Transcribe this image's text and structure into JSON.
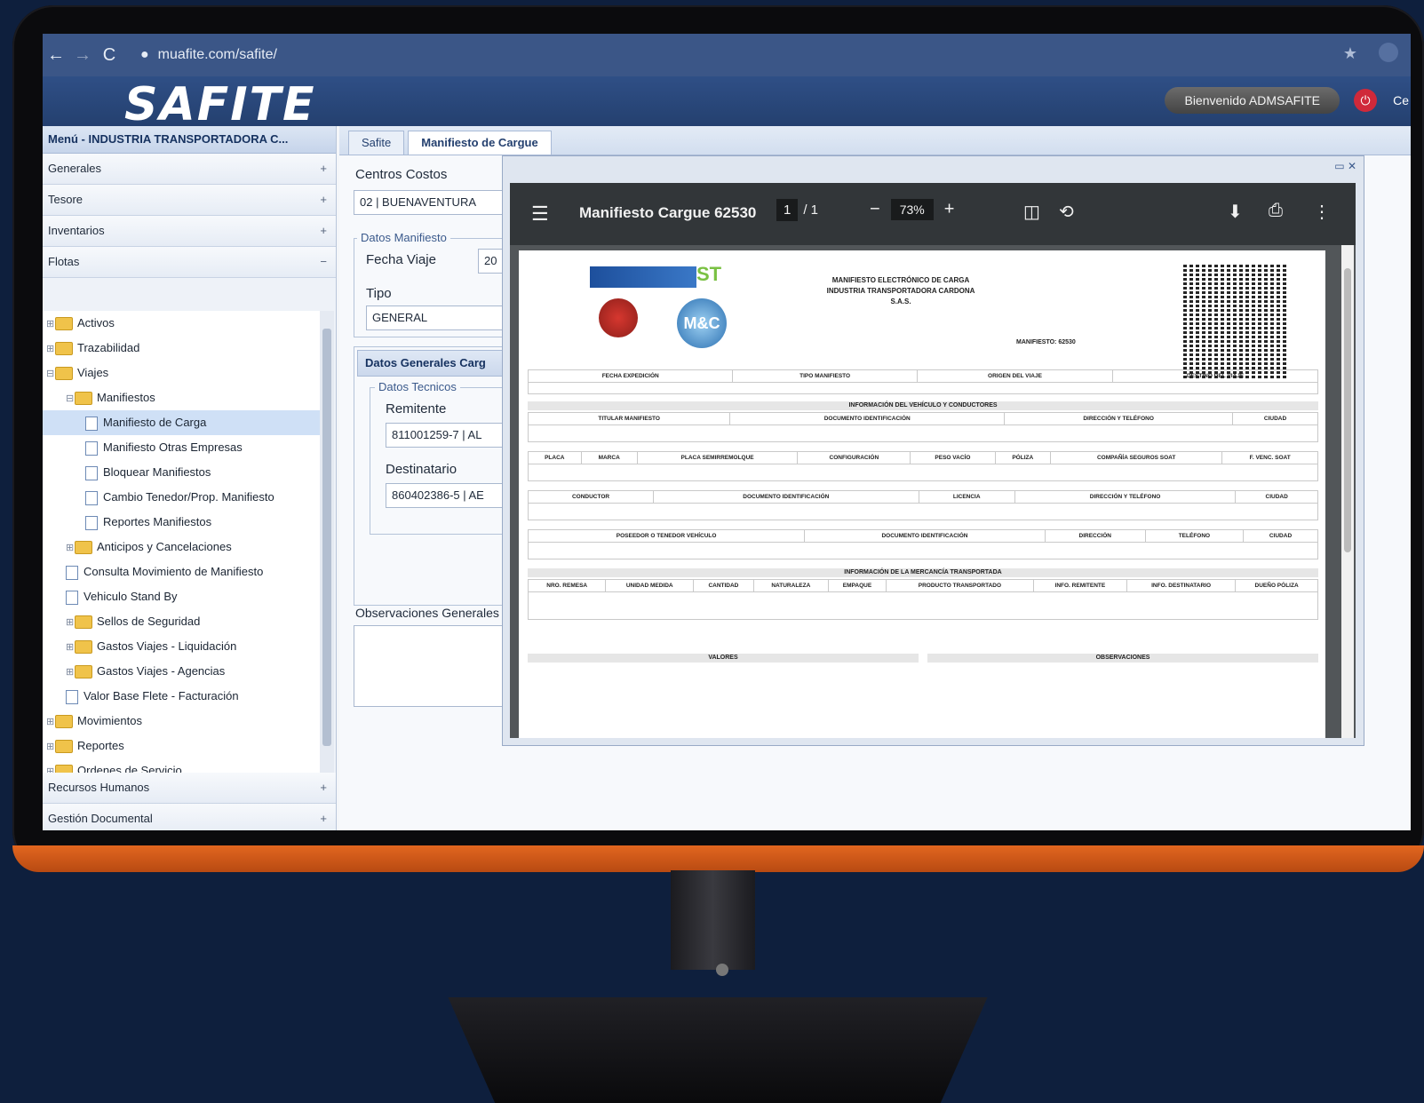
{
  "browser": {
    "back_icon": "←",
    "forward_icon": "→",
    "reload_icon": "C",
    "url": "muafite.com/safite/"
  },
  "app": {
    "logo": "SAFITE",
    "welcome": "Bienvenido ADMSAFITE",
    "logout_text": "Ce"
  },
  "sidebar": {
    "menu_title": "Menú - INDUSTRIA TRANSPORTADORA C...",
    "accordions_top": [
      "Generales",
      "Tesore",
      "Inventarios",
      "Flotas"
    ],
    "tree": [
      {
        "label": "Activos",
        "kind": "folder",
        "level": 0,
        "pm": "+"
      },
      {
        "label": "Trazabilidad",
        "kind": "folder",
        "level": 0,
        "pm": "+"
      },
      {
        "label": "Viajes",
        "kind": "folder",
        "level": 0,
        "pm": "-"
      },
      {
        "label": "Manifiestos",
        "kind": "folder",
        "level": 1,
        "pm": "-"
      },
      {
        "label": "Manifiesto de Carga",
        "kind": "doc",
        "level": 2,
        "selected": true
      },
      {
        "label": "Manifiesto Otras Empresas",
        "kind": "doc",
        "level": 2
      },
      {
        "label": "Bloquear Manifiestos",
        "kind": "doc",
        "level": 2
      },
      {
        "label": "Cambio Tenedor/Prop. Manifiesto",
        "kind": "doc",
        "level": 2
      },
      {
        "label": "Reportes Manifiestos",
        "kind": "doc",
        "level": 2
      },
      {
        "label": "Anticipos y Cancelaciones",
        "kind": "folder",
        "level": 1,
        "pm": "+"
      },
      {
        "label": "Consulta Movimiento de Manifiesto",
        "kind": "doc",
        "level": 1
      },
      {
        "label": "Vehiculo Stand By",
        "kind": "doc",
        "level": 1
      },
      {
        "label": "Sellos de Seguridad",
        "kind": "folder",
        "level": 1,
        "pm": "+"
      },
      {
        "label": "Gastos Viajes - Liquidación",
        "kind": "folder",
        "level": 1,
        "pm": "+"
      },
      {
        "label": "Gastos Viajes - Agencias",
        "kind": "folder",
        "level": 1,
        "pm": "+"
      },
      {
        "label": "Valor Base Flete - Facturación",
        "kind": "doc",
        "level": 1
      },
      {
        "label": "Movimientos",
        "kind": "folder",
        "level": 0,
        "pm": "+"
      },
      {
        "label": "Reportes",
        "kind": "folder",
        "level": 0,
        "pm": "+"
      },
      {
        "label": "Ordenes de Servicio",
        "kind": "folder",
        "level": 0,
        "pm": "+"
      }
    ],
    "accordions_bottom": [
      "Recursos Humanos",
      "Gestión Documental"
    ]
  },
  "main": {
    "tabs": [
      "Safite",
      "Manifiesto de Cargue"
    ],
    "centros_label": "Centros Costos",
    "centros_value": "02 | BUENAVENTURA",
    "datos_manifiesto_legend": "Datos Manifiesto",
    "fecha_label": "Fecha Viaje",
    "fecha_value": "20",
    "tipo_label": "Tipo",
    "tipo_value": "GENERAL",
    "panel_title": "Datos Generales Carg",
    "datos_tecnicos_legend": "Datos Tecnicos",
    "remitente_label": "Remitente",
    "remitente_value": "811001259-7 | AL",
    "destinatario_label": "Destinatario",
    "destinatario_value": "860402386-5 | AE",
    "observaciones_label": "Observaciones Generales"
  },
  "pdf": {
    "title": "Manifiesto Cargue 62530",
    "page_current": "1",
    "page_total": "/ 1",
    "zoom": "73%",
    "doc_heading": [
      "MANIFIESTO ELECTRÓNICO DE CARGA",
      "INDUSTRIA TRANSPORTADORA CARDONA",
      "S.A.S."
    ],
    "manifiesto_label": "MANIFIESTO: 62530",
    "logo_st": "ST",
    "logo_ms": "M&C",
    "header_row": [
      "FECHA EXPEDICIÓN",
      "TIPO MANIFIESTO",
      "ORIGEN DEL VIAJE",
      "DESTINO DEL VIAJE"
    ],
    "section_vehiculo": "INFORMACIÓN DEL VEHÍCULO Y CONDUCTORES",
    "vehiculo_row1": [
      "TITULAR MANIFIESTO",
      "DOCUMENTO IDENTIFICACIÓN",
      "DIRECCIÓN Y TELÉFONO",
      "CIUDAD"
    ],
    "vehiculo_row2": [
      "PLACA",
      "MARCA",
      "PLACA SEMIRREMOLQUE",
      "CONFIGURACIÓN",
      "PESO VACÍO",
      "PÓLIZA",
      "COMPAÑÍA SEGUROS SOAT",
      "F. VENC. SOAT"
    ],
    "vehiculo_row3": [
      "CONDUCTOR",
      "DOCUMENTO IDENTIFICACIÓN",
      "LICENCIA",
      "DIRECCIÓN Y TELÉFONO",
      "CIUDAD"
    ],
    "vehiculo_row4": [
      "POSEEDOR O TENEDOR VEHÍCULO",
      "DOCUMENTO IDENTIFICACIÓN",
      "DIRECCIÓN",
      "TELÉFONO",
      "CIUDAD"
    ],
    "section_mercancia": "INFORMACIÓN DE LA MERCANCÍA TRANSPORTADA",
    "mercancia_row": [
      "NRO. REMESA",
      "UNIDAD MEDIDA",
      "CANTIDAD",
      "NATURALEZA",
      "EMPAQUE",
      "PRODUCTO TRANSPORTADO",
      "INFO. REMITENTE",
      "INFO. DESTINATARIO",
      "DUEÑO PÓLIZA"
    ],
    "valores_title": "VALORES",
    "observaciones_title": "OBSERVACIONES"
  }
}
